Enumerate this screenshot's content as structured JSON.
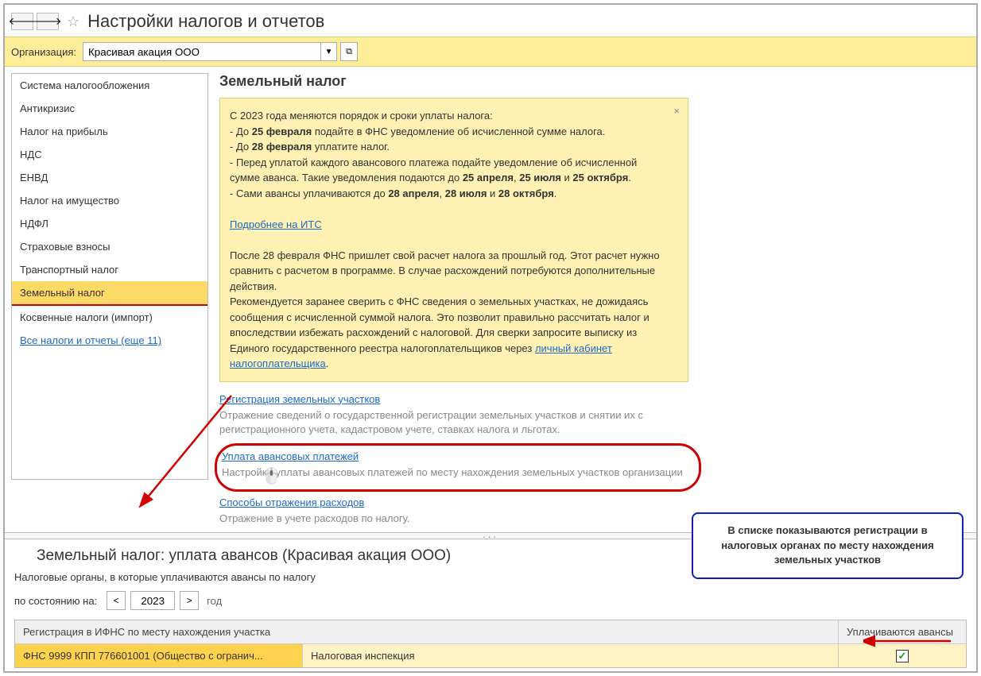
{
  "page_title": "Настройки налогов и отчетов",
  "org": {
    "label": "Организация:",
    "value": "Красивая акация ООО"
  },
  "sidebar": {
    "items": [
      "Система налогообложения",
      "Антикризис",
      "Налог на прибыль",
      "НДС",
      "ЕНВД",
      "Налог на имущество",
      "НДФЛ",
      "Страховые взносы",
      "Транспортный налог",
      "Земельный налог",
      "Косвенные налоги (импорт)"
    ],
    "more_link": "Все налоги и отчеты (еще 11)"
  },
  "content": {
    "title": "Земельный налог",
    "notice": {
      "intro": "С 2023 года меняются порядок и сроки уплаты налога:",
      "l1a": " - До ",
      "l1b": "25 февраля",
      "l1c": " подайте в ФНС уведомление об исчисленной сумме налога.",
      "l2a": " - До ",
      "l2b": "28 февраля",
      "l2c": " уплатите налог.",
      "l3a": " - Перед уплатой каждого авансового платежа подайте уведомление об исчисленной сумме аванса. Такие уведомления подаются до ",
      "l3b": "25 апреля",
      "l3c": ", ",
      "l3d": "25 июля",
      "l3e": " и ",
      "l3f": "25 октября",
      "l3g": ".",
      "l4a": " - Сами авансы уплачиваются до ",
      "l4b": "28 апреля",
      "l4c": ", ",
      "l4d": "28 июля",
      "l4e": " и ",
      "l4f": "28 октября",
      "l4g": ".",
      "more_link": "Подробнее на ИТС",
      "para2": "После 28 февраля ФНС пришлет свой расчет налога за прошлый год. Этот расчет нужно сравнить с расчетом в программе. В случае расхождений потребуются дополнительные действия.",
      "para3a": "Рекомендуется заранее сверить с ФНС сведения о земельных участках, не дожидаясь сообщения с исчисленной суммой налога. Это позволит правильно рассчитать налог и впоследствии избежать расхождений с налоговой. Для сверки запросите выписку из Единого государственного реестра налогоплательщиков через ",
      "para3_link": "личный кабинет налогоплательщика",
      "para3b": "."
    },
    "reg": {
      "link": "Регистрация земельных участков",
      "hint": "Отражение сведений о государственной регистрации земельных участков и снятии их с регистрационного учета, кадастровом учете, ставках налога и льготах."
    },
    "adv": {
      "link": "Уплата авансовых платежей",
      "hint": "Настройка уплаты авансовых платежей по месту нахождения земельных участков организации"
    },
    "exp": {
      "link": "Способы отражения расходов",
      "hint": "Отражение в учете расходов по налогу."
    }
  },
  "bottom": {
    "title": "Земельный налог: уплата авансов (Красивая акация ООО)",
    "subtitle": "Налоговые органы, в которые уплачиваются авансы по налогу",
    "year_label": "по состоянию на:",
    "year": "2023",
    "year_unit": "год",
    "grid": {
      "col_left": "Регистрация в ИФНС по месту нахождения участка",
      "col_right": "Уплачиваются авансы",
      "row": {
        "c1": "ФНС 9999 КПП 776601001 (Общество с огранич...",
        "c2": "Налоговая инспекция",
        "checked": "✓"
      }
    }
  },
  "callout": "В списке показываются регистрации в налоговых органах по месту нахождения земельных участков"
}
